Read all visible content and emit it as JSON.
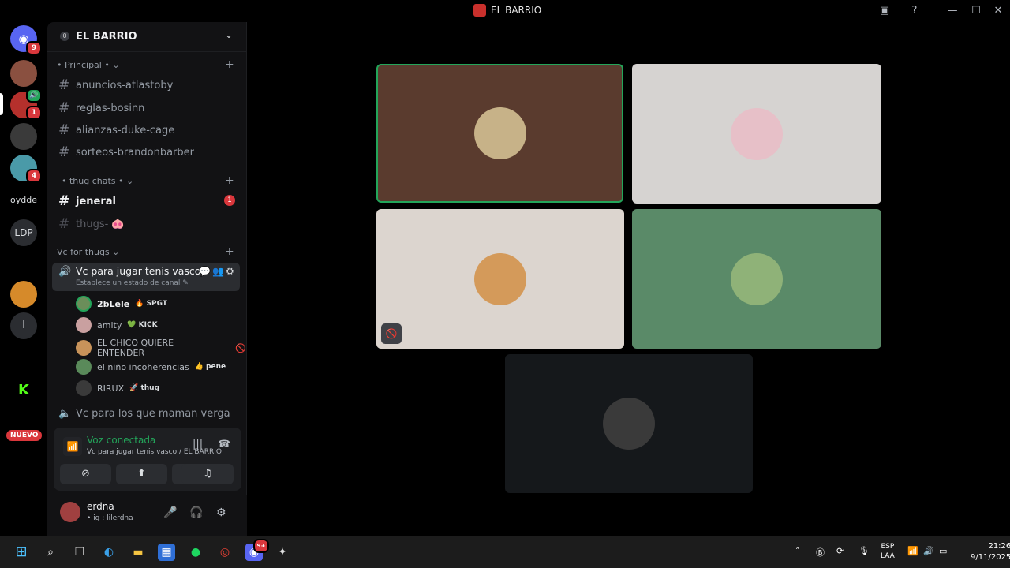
{
  "window": {
    "title": "EL BARRIO"
  },
  "servers": {
    "discord_badge": "9",
    "items": [
      {
        "badge": ""
      },
      {
        "badge": "1",
        "badge2": "1"
      },
      {
        "badge": ""
      },
      {
        "badge": "4"
      }
    ],
    "text_items": [
      "oydde",
      "LDP",
      "l"
    ],
    "nuevo": "NUEVO"
  },
  "server": {
    "level": "0",
    "name": "EL BARRIO"
  },
  "categories": {
    "principal": "• Principal •",
    "thug": "• thug chats •",
    "vc": "Vc for thugs"
  },
  "channels": {
    "principal": [
      "anuncios-atlastoby",
      "reglas-bosinn",
      "alianzas-duke-cage",
      "sorteos-brandonbarber"
    ],
    "thug": [
      {
        "name": "jeneral",
        "badge": "1"
      },
      {
        "name": "thugs- 🐽"
      }
    ]
  },
  "voice_channel": {
    "name": "Vc para jugar tenis vasco",
    "status_hint": "Establece un estado de canal ✎",
    "members": [
      {
        "name": "2bLele",
        "tag": "🔥 SPGT",
        "color": "#6b8e5a"
      },
      {
        "name": "amity",
        "tag": "💚 KICK",
        "color": "#c9a0a0"
      },
      {
        "name": "EL CHICO QUIERE ENTENDER",
        "tag": "",
        "color": "#c8935a"
      },
      {
        "name": "el niño incoherencias",
        "tag": "👍 pene",
        "color": "#5a8a5a"
      },
      {
        "name": "RIRUX",
        "tag": "🚀 thug",
        "color": "#3a3a3a"
      }
    ],
    "other": "Vc para los que maman verga"
  },
  "voice_panel": {
    "title": "Voz conectada",
    "subtitle": "Vc para jugar tenis vasco / EL BARRIO"
  },
  "user": {
    "name": "erdna",
    "status": "• ig : lilerdna"
  },
  "tiles": [
    {
      "bg": "#5a3b2e",
      "avatar": "#c7b288"
    },
    {
      "bg": "#d6d3d1",
      "avatar": "#e7c0c8"
    },
    {
      "bg": "#dcd5cf",
      "avatar": "#d49a5a"
    },
    {
      "bg": "#5a8a68",
      "avatar": "#8fb278"
    },
    {
      "bg": "#15181b",
      "avatar": "#3a3a3a"
    }
  ],
  "taskbar": {
    "discord_badge": "9+",
    "lang1": "ESP",
    "lang2": "LAA",
    "time": "21:26",
    "date": "9/11/2025"
  }
}
